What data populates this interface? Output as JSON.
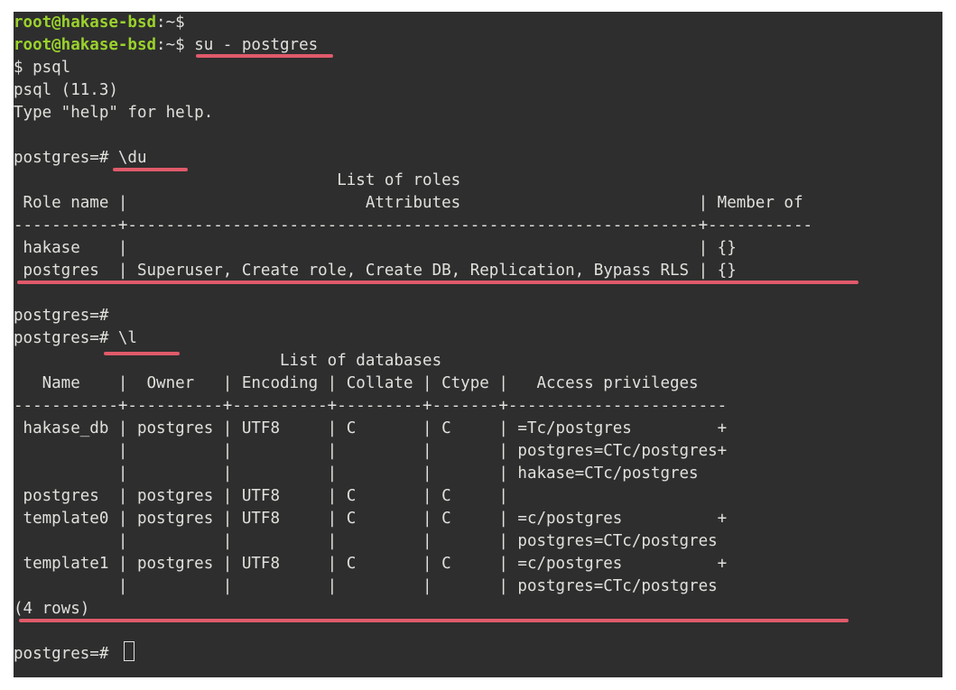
{
  "highlight_color": "#e05a6a",
  "prompt_user": "root@hakase-bsd",
  "prompt_path": ":~$",
  "cmd_su": " su - postgres",
  "terminal_lines": [
    "$ psql",
    "psql (11.3)",
    "Type \"help\" for help.",
    "",
    "postgres=# \\du",
    "                                  List of roles",
    " Role name |                         Attributes                         | Member of",
    "-----------+------------------------------------------------------------+-----------",
    " hakase    |                                                            | {}",
    " postgres  | Superuser, Create role, Create DB, Replication, Bypass RLS | {}",
    "",
    "postgres=#",
    "postgres=# \\l",
    "                            List of databases",
    "   Name    |  Owner   | Encoding | Collate | Ctype |   Access privileges",
    "-----------+----------+----------+---------+-------+-----------------------",
    " hakase_db | postgres | UTF8     | C       | C     | =Tc/postgres         +",
    "           |          |          |         |       | postgres=CTc/postgres+",
    "           |          |          |         |       | hakase=CTc/postgres",
    " postgres  | postgres | UTF8     | C       | C     |",
    " template0 | postgres | UTF8     | C       | C     | =c/postgres          +",
    "           |          |          |         |       | postgres=CTc/postgres",
    " template1 | postgres | UTF8     | C       | C     | =c/postgres          +",
    "           |          |          |         |       | postgres=CTc/postgres",
    "(4 rows)",
    "",
    "postgres=# "
  ]
}
